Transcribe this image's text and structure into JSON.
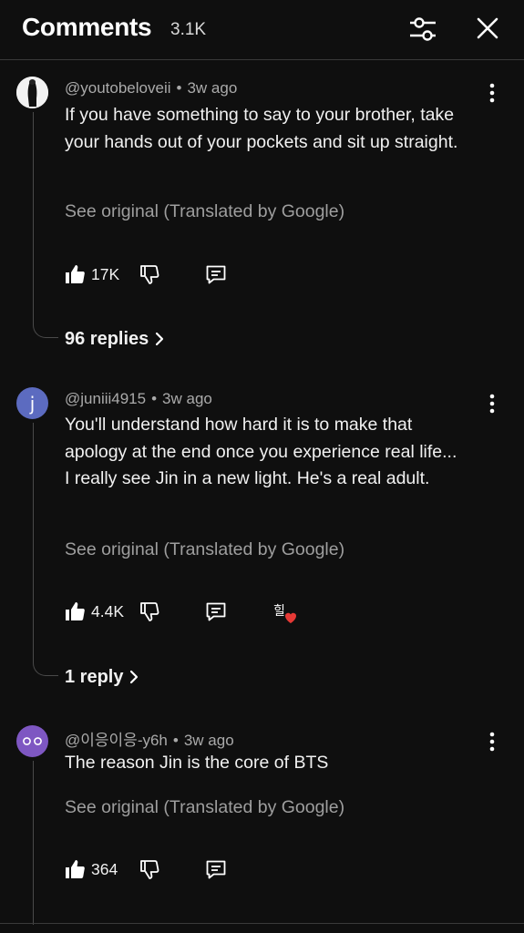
{
  "header": {
    "title": "Comments",
    "count": "3.1K"
  },
  "comments": [
    {
      "author": "@youtobeloveii",
      "time": "3w ago",
      "text": "If you have something to say to your brother, take your hands out of your pockets and sit up straight.",
      "see_original": "See original (Translated by Google)",
      "likes": "17K",
      "replies_label": "96 replies",
      "avatar_letter": ""
    },
    {
      "author": "@juniii4915",
      "time": "3w ago",
      "text": "You'll understand how hard it is to make that apology at the end once you experience real life... I really see Jin in a new light. He's a real adult.",
      "see_original": "See original (Translated by Google)",
      "likes": "4.4K",
      "replies_label": "1 reply",
      "avatar_letter": "j",
      "avatar_color": "#5c6bc0",
      "creator_badge": "힐"
    },
    {
      "author": "@이응이응-y6h",
      "time": "3w ago",
      "text": "The reason Jin is the core of BTS",
      "see_original": "See original (Translated by Google)",
      "likes": "364",
      "avatar_color": "#7e57c2"
    }
  ],
  "colors": {
    "background": "#0f0f0f",
    "heart": "#e53935"
  }
}
